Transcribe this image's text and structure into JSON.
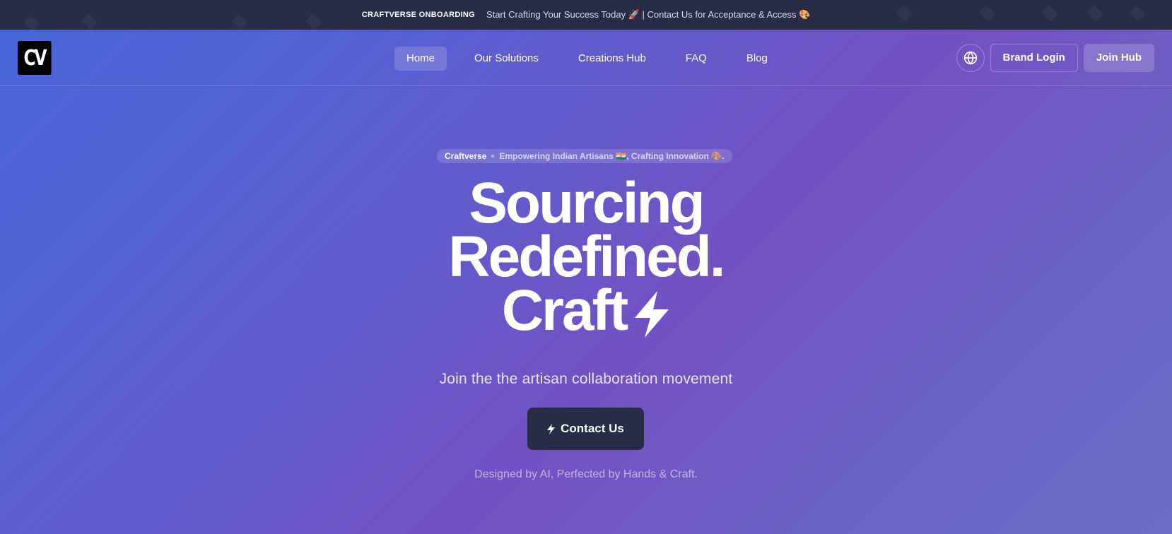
{
  "announcement": {
    "tag": "CRAFTVERSE ONBOARDING",
    "message": "Start Crafting Your Success Today 🚀 | Contact Us for Acceptance & Access 🎨"
  },
  "header": {
    "logo_text": "CV",
    "nav": [
      {
        "label": "Home",
        "active": true
      },
      {
        "label": "Our Solutions",
        "active": false
      },
      {
        "label": "Creations Hub",
        "active": false
      },
      {
        "label": "FAQ",
        "active": false
      },
      {
        "label": "Blog",
        "active": false
      }
    ],
    "language_icon": "globe-icon",
    "brand_login_label": "Brand Login",
    "join_hub_label": "Join Hub"
  },
  "hero": {
    "badge": {
      "brand": "Craftverse",
      "text": "Empowering Indian Artisans 🇮🇳, Crafting Innovation 🎨."
    },
    "headline": {
      "line1": "Sourcing",
      "line2": "Redefined.",
      "line3": "Craft",
      "line3_icon": "lightning-bolt-icon"
    },
    "subheading": "Join the the artisan collaboration movement",
    "cta_label": "Contact Us",
    "cta_icon": "lightning-bolt-icon",
    "tagline": "Designed by AI, Perfected by Hands & Craft."
  },
  "colors": {
    "announcement_bg": "#282c47",
    "cta_bg": "#282c47",
    "gradient_start": "#4766da",
    "gradient_mid": "#7252c2",
    "gradient_end": "#6a6cc6",
    "text_primary": "#ffffff"
  }
}
